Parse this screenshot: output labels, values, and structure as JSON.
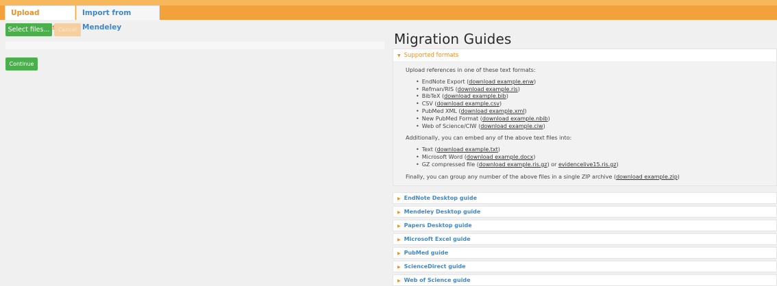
{
  "tabs": [
    {
      "label": "Upload References"
    },
    {
      "label": "Import from Mendeley"
    }
  ],
  "upload": {
    "select_label": "Select files...",
    "cancel_label": "Cancel",
    "continue_label": "Continue"
  },
  "guides": {
    "title": "Migration Guides",
    "open_panel": {
      "header": "Supported formats",
      "intro": "Upload references in one of these text formats:",
      "formats": [
        {
          "name": "EndNote Export",
          "link": "download example.enw"
        },
        {
          "name": "Refman/RIS",
          "link": "download example.ris"
        },
        {
          "name": "BibTeX",
          "link": "download example.bib"
        },
        {
          "name": "CSV",
          "link": "download example.csv"
        },
        {
          "name": "PubMed XML",
          "link": "download example.xml"
        },
        {
          "name": "New PubMed Format",
          "link": "download example.nbib"
        },
        {
          "name": "Web of Science/CIW",
          "link": "download example.ciw"
        }
      ],
      "embed_intro": "Additionally, you can embed any of the above text files into:",
      "embeds": [
        {
          "name": "Text",
          "link": "download example.txt"
        },
        {
          "name": "Microsoft Word",
          "link": "download example.docx"
        },
        {
          "name": "GZ compressed file",
          "link": "download example.ris.gz",
          "or": "or",
          "link2": "evidencelive15.ris.gz"
        }
      ],
      "zip_text": "Finally, you can group any number of the above files in a single ZIP archive",
      "zip_link": "download example.zip"
    },
    "sections": [
      "EndNote Desktop guide",
      "Mendeley Desktop guide",
      "Papers Desktop guide",
      "Microsoft Excel guide",
      "PubMed guide",
      "ScienceDirect guide",
      "Web of Science guide"
    ]
  },
  "colors": {
    "accent_orange": "#f3a13b",
    "button_green": "#4cae4c",
    "link_blue": "#3e88c7"
  }
}
